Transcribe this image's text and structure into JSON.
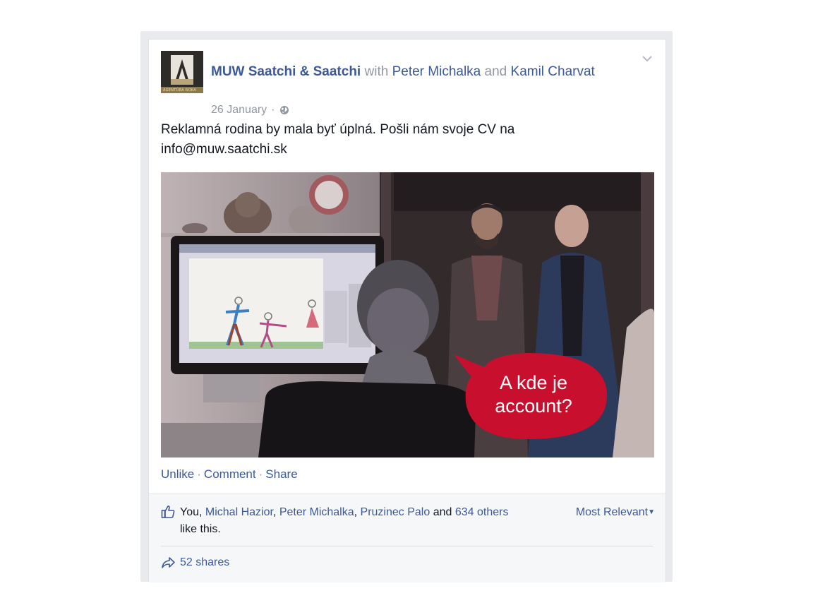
{
  "post": {
    "author": "MUW Saatchi & Saatchi",
    "with_word": "with",
    "and_word": "and",
    "tagged_1": "Peter Michalka",
    "tagged_2": "Kamil Charvat",
    "date": "26 January",
    "meta_sep": "·",
    "privacy_icon": "globe-icon",
    "text_line1": "Reklamná rodina by mala byť úplná. Pošli nám svoje CV na",
    "text_line2": "info@muw.saatchi.sk",
    "avatar_caption": "AGENTÚRA ROKA",
    "image": {
      "speech_bubble_line1": "A kde je",
      "speech_bubble_line2": "account?"
    }
  },
  "actions": {
    "unlike": "Unlike",
    "comment": "Comment",
    "share": "Share",
    "sep": "·"
  },
  "likes": {
    "you": "You",
    "name_1": "Michal Hazior",
    "name_2": "Peter Michalka",
    "name_3": "Pruzinec Palo",
    "and_word": "and",
    "others": "634 others",
    "suffix": "like this.",
    "sort_label": "Most Relevant",
    "sort_caret": "▼"
  },
  "shares": {
    "label": "52 shares"
  },
  "colors": {
    "link": "#3b5998",
    "muted": "#9197a3",
    "text": "#141823",
    "bubble": "#c8102e"
  }
}
